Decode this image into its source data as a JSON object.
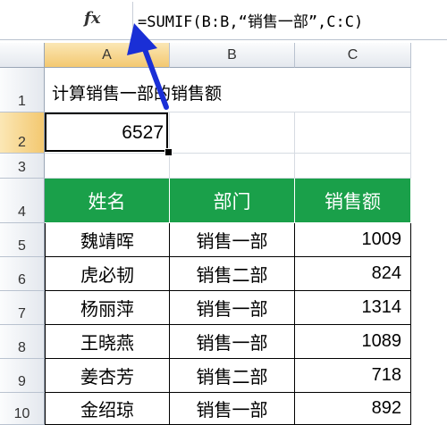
{
  "formula_bar": {
    "fx_label": "fx",
    "formula": "=SUMIF(B:B,“销售一部”,C:C)"
  },
  "columns": [
    "A",
    "B",
    "C"
  ],
  "rows": [
    "1",
    "2",
    "3",
    "4",
    "5",
    "6",
    "7",
    "8",
    "9",
    "10"
  ],
  "selected_cell": "A2",
  "cells": {
    "a1": "计算销售一部的销售额",
    "a2": "6527"
  },
  "table": {
    "headers": [
      "姓名",
      "部门",
      "销售额"
    ],
    "header_color": "#1aa04a",
    "rows": [
      [
        "魏靖晖",
        "销售一部",
        "1009"
      ],
      [
        "虎必韧",
        "销售二部",
        "824"
      ],
      [
        "杨丽萍",
        "销售一部",
        "1314"
      ],
      [
        "王晓燕",
        "销售一部",
        "1089"
      ],
      [
        "姜杏芳",
        "销售二部",
        "718"
      ],
      [
        "金绍琼",
        "销售一部",
        "892"
      ]
    ]
  },
  "annotation": {
    "arrow_color": "#1a2fd6",
    "icon": "arrow-up-left-icon"
  }
}
